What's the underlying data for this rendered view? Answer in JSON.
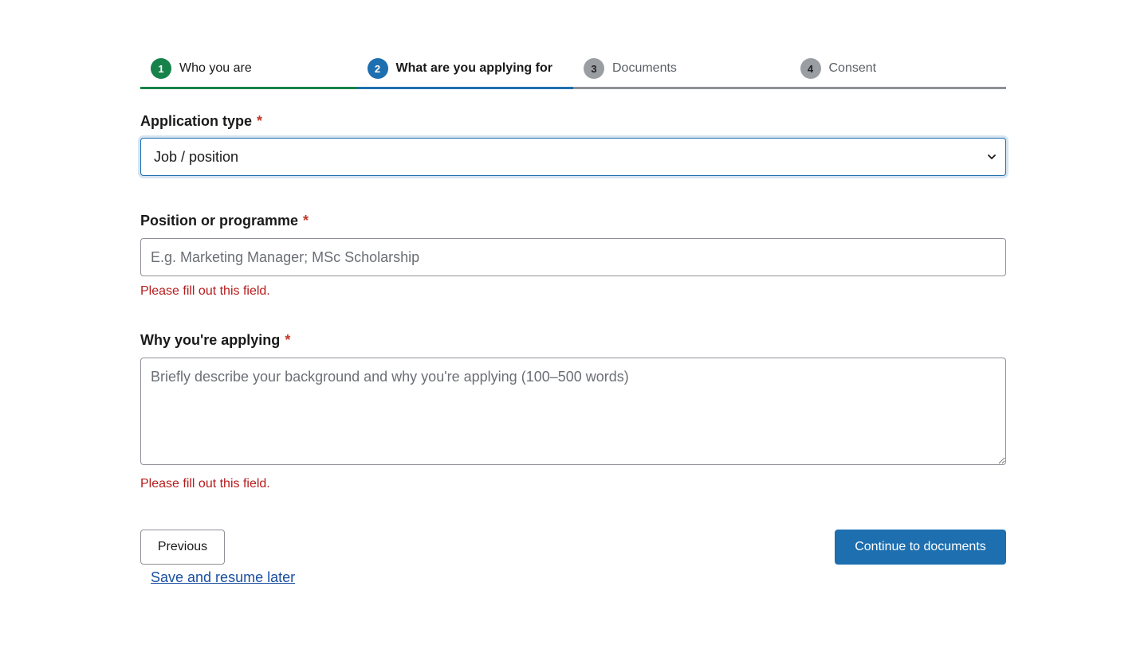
{
  "stepper": {
    "steps": [
      {
        "number": "1",
        "label": "Who you are",
        "state": "done"
      },
      {
        "number": "2",
        "label": "What are you applying for",
        "state": "active"
      },
      {
        "number": "3",
        "label": "Documents",
        "state": "todo"
      },
      {
        "number": "4",
        "label": "Consent",
        "state": "todo"
      }
    ]
  },
  "form": {
    "application_type": {
      "label": "Application type",
      "required_mark": "*",
      "selected_value": "Job / position"
    },
    "position": {
      "label": "Position or programme",
      "required_mark": "*",
      "value": "",
      "placeholder": "E.g. Marketing Manager; MSc Scholarship",
      "error": "Please fill out this field."
    },
    "why": {
      "label": "Why you're applying",
      "required_mark": "*",
      "value": "",
      "placeholder": "Briefly describe your background and why you're applying (100–500 words)",
      "error": "Please fill out this field."
    }
  },
  "actions": {
    "previous_label": "Previous",
    "continue_label": "Continue to documents",
    "save_link_label": "Save and resume later"
  },
  "colors": {
    "done": "#17824a",
    "active": "#1d6fb0",
    "todo": "#8d9196",
    "error": "#b51c1c",
    "primary_button": "#1d6fb0",
    "link": "#1a4fa0"
  },
  "icons": {
    "select_chevron": "chevron-down-icon"
  }
}
